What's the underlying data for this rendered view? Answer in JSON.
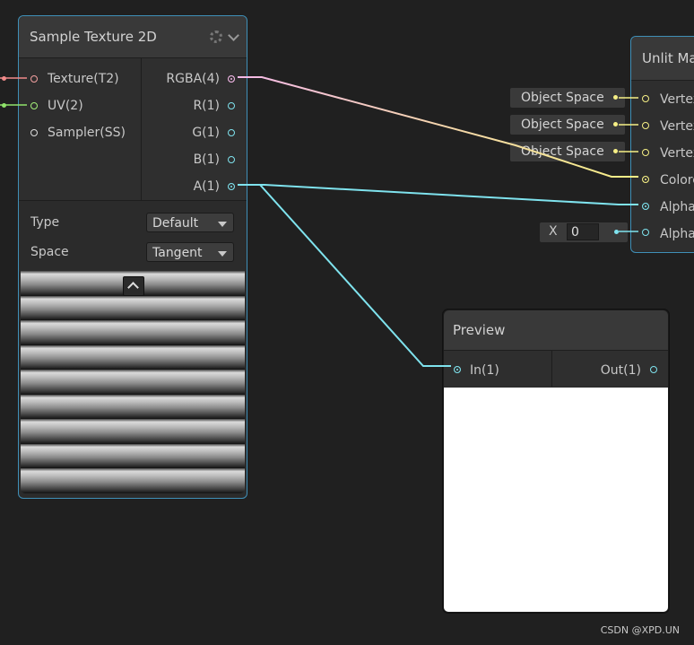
{
  "sample_node": {
    "title": "Sample Texture 2D",
    "inputs": [
      "Texture(T2)",
      "UV(2)",
      "Sampler(SS)"
    ],
    "outputs": [
      "RGBA(4)",
      "R(1)",
      "G(1)",
      "B(1)",
      "A(1)"
    ],
    "type_label": "Type",
    "type_value": "Default",
    "space_label": "Space",
    "space_value": "Tangent"
  },
  "unlit_node": {
    "title": "Unlit Ma",
    "inputs": [
      "Vertex",
      "Vertex",
      "Vertex",
      "Colore",
      "Alpha",
      "Alpha"
    ]
  },
  "object_space": [
    "Object Space",
    "Object Space",
    "Object Space"
  ],
  "alpha_clip": {
    "axis_label": "X",
    "value": "0"
  },
  "preview_node": {
    "title": "Preview",
    "input": "In(1)",
    "output": "Out(1)"
  },
  "watermark": "CSDN @XPD.UN",
  "colors": {
    "texture_port": "#f4a0a0",
    "uv_port": "#a4f07a",
    "rgba_wire_start": "#f4b8e8",
    "rgba_wire_end": "#f6ef85",
    "alpha_wire": "#7fe3ee",
    "selection_border": "#3f8fb7"
  }
}
